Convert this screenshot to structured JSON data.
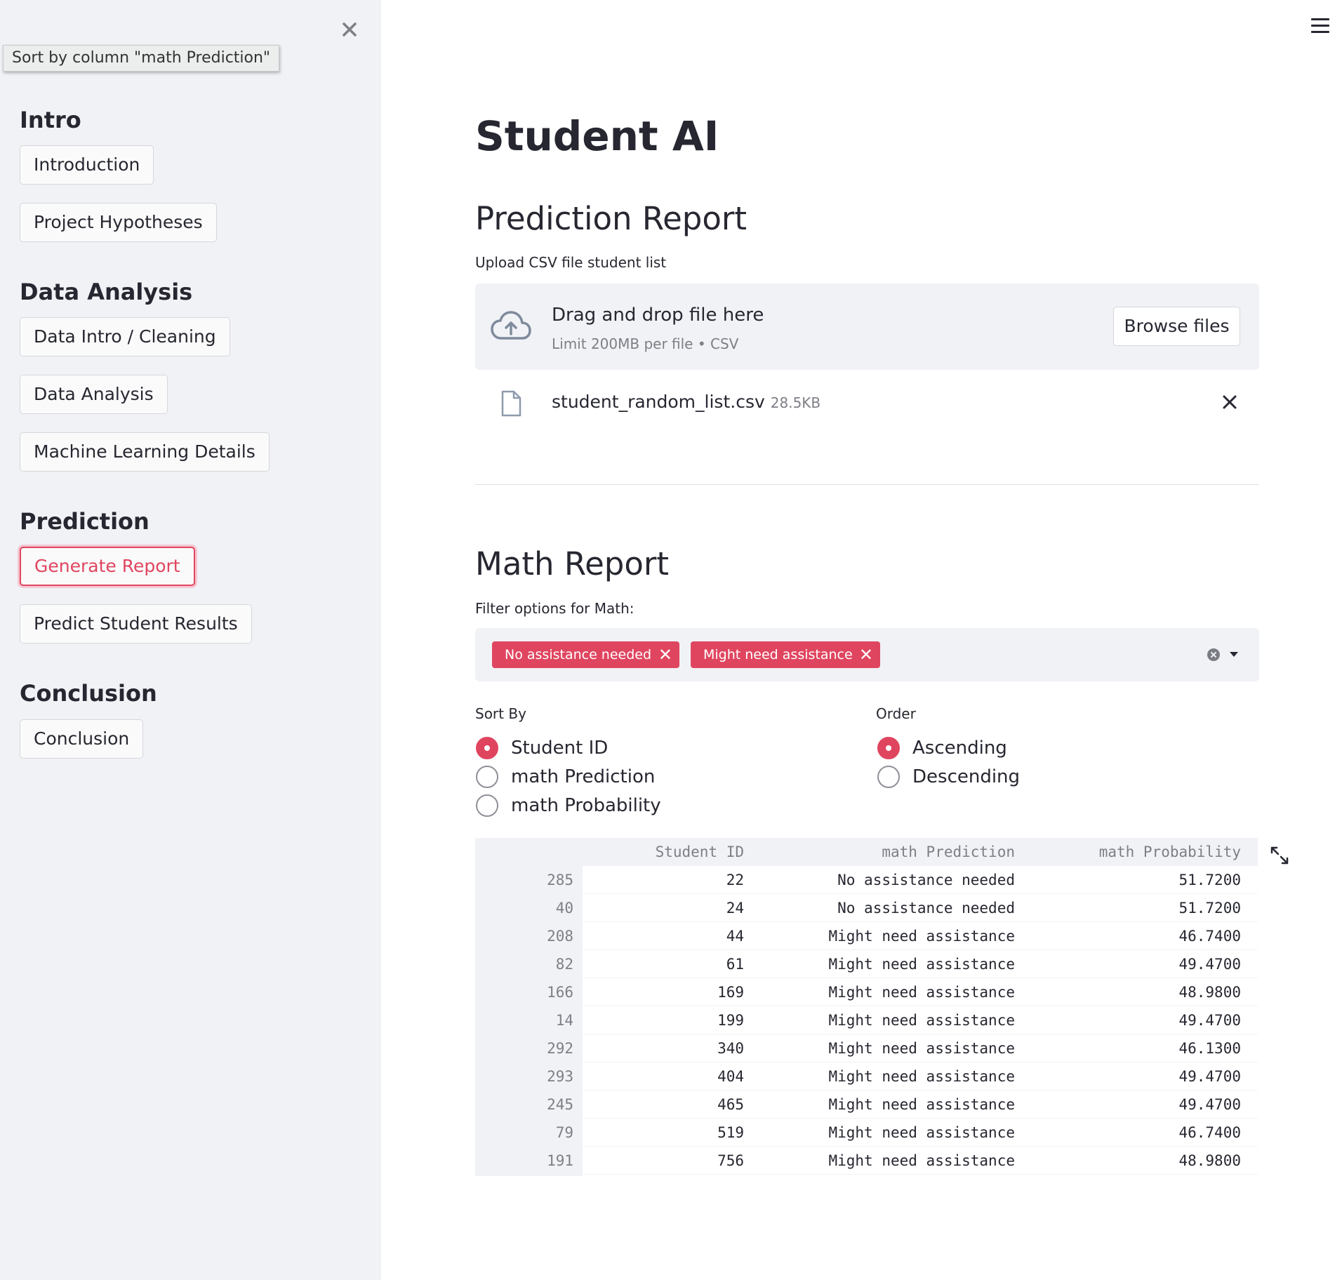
{
  "sidebar": {
    "tooltip": "Sort by column \"math Prediction\"",
    "sections": [
      {
        "heading": "Intro",
        "buttons": [
          "Introduction",
          "Project Hypotheses"
        ]
      },
      {
        "heading": "Data Analysis",
        "buttons": [
          "Data Intro / Cleaning",
          "Data Analysis",
          "Machine Learning Details"
        ]
      },
      {
        "heading": "Prediction",
        "buttons": [
          "Generate Report",
          "Predict Student Results"
        ]
      },
      {
        "heading": "Conclusion",
        "buttons": [
          "Conclusion"
        ]
      }
    ],
    "active_button": "Generate Report"
  },
  "main": {
    "title": "Student AI",
    "prediction_report": {
      "heading": "Prediction Report",
      "upload_label": "Upload CSV file student list",
      "drop_text": "Drag and drop file here",
      "drop_sub": "Limit 200MB per file • CSV",
      "browse_label": "Browse files",
      "file_name": "student_random_list.csv",
      "file_size": "28.5KB"
    },
    "math_report": {
      "heading": "Math Report",
      "filter_label": "Filter options for Math:",
      "tags": [
        "No assistance needed",
        "Might need assistance"
      ],
      "sort_by_label": "Sort By",
      "sort_options": [
        "Student ID",
        "math Prediction",
        "math Probability"
      ],
      "sort_selected": "Student ID",
      "order_label": "Order",
      "order_options": [
        "Ascending",
        "Descending"
      ],
      "order_selected": "Ascending"
    },
    "table": {
      "columns": [
        "Student ID",
        "math Prediction",
        "math Probability"
      ],
      "rows": [
        {
          "index": "285",
          "student_id": "22",
          "prediction": "No assistance needed",
          "probability": "51.7200"
        },
        {
          "index": "40",
          "student_id": "24",
          "prediction": "No assistance needed",
          "probability": "51.7200"
        },
        {
          "index": "208",
          "student_id": "44",
          "prediction": "Might need assistance",
          "probability": "46.7400"
        },
        {
          "index": "82",
          "student_id": "61",
          "prediction": "Might need assistance",
          "probability": "49.4700"
        },
        {
          "index": "166",
          "student_id": "169",
          "prediction": "Might need assistance",
          "probability": "48.9800"
        },
        {
          "index": "14",
          "student_id": "199",
          "prediction": "Might need assistance",
          "probability": "49.4700"
        },
        {
          "index": "292",
          "student_id": "340",
          "prediction": "Might need assistance",
          "probability": "46.1300"
        },
        {
          "index": "293",
          "student_id": "404",
          "prediction": "Might need assistance",
          "probability": "49.4700"
        },
        {
          "index": "245",
          "student_id": "465",
          "prediction": "Might need assistance",
          "probability": "49.4700"
        },
        {
          "index": "79",
          "student_id": "519",
          "prediction": "Might need assistance",
          "probability": "46.7400"
        },
        {
          "index": "191",
          "student_id": "756",
          "prediction": "Might need assistance",
          "probability": "48.9800"
        }
      ]
    }
  },
  "colors": {
    "accent": "#e0455f",
    "sidebar_bg": "#f0f2f6",
    "text": "#262730",
    "muted": "#7e7f86"
  },
  "icons": [
    "close-icon",
    "menu-icon",
    "upload-cloud-icon",
    "file-icon",
    "remove-file-icon",
    "clear-all-icon",
    "chevron-down-icon",
    "fullscreen-icon"
  ]
}
